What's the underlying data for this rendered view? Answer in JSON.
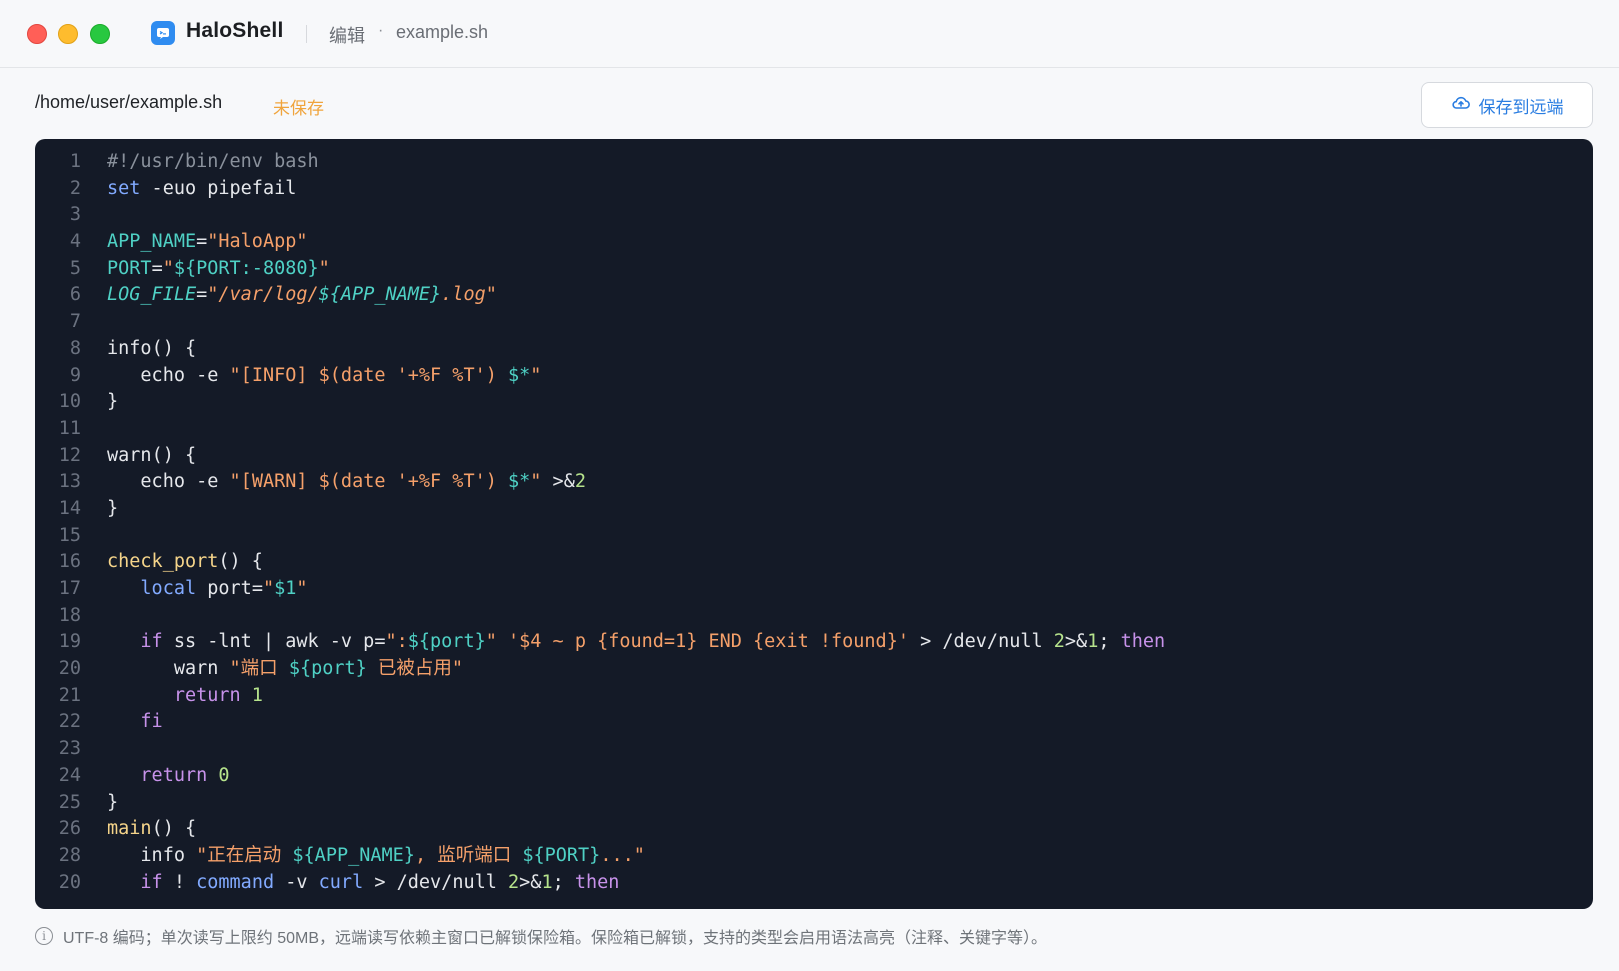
{
  "titlebar": {
    "app_name": "HaloShell",
    "mode": "编辑",
    "separator": "·",
    "file_name": "example.sh"
  },
  "toolbar": {
    "path": "/home/user/example.sh",
    "status": "未保存",
    "save_label": "保存到远端",
    "save_icon": "cloud-upload-icon"
  },
  "editor": {
    "lines": [
      {
        "n": "1",
        "code": "#!/usr/bin/env bash"
      },
      {
        "n": "2",
        "code": "set -euo pipefail"
      },
      {
        "n": "3",
        "code": ""
      },
      {
        "n": "4",
        "code": "APP_NAME=\"HaloApp\""
      },
      {
        "n": "5",
        "code": "PORT=\"${PORT:-8080}\""
      },
      {
        "n": "6",
        "code": "LOG_FILE=\"/var/log/${APP_NAME}.log\""
      },
      {
        "n": "7",
        "code": ""
      },
      {
        "n": "8",
        "code": "info() {"
      },
      {
        "n": "9",
        "code": "   echo -e \"[INFO] $(date '+%F %T') $*\""
      },
      {
        "n": "10",
        "code": "}"
      },
      {
        "n": "11",
        "code": ""
      },
      {
        "n": "12",
        "code": "warn() {"
      },
      {
        "n": "13",
        "code": "   echo -e \"[WARN] $(date '+%F %T') $*\" >&2"
      },
      {
        "n": "14",
        "code": "}"
      },
      {
        "n": "15",
        "code": ""
      },
      {
        "n": "16",
        "code": "check_port() {"
      },
      {
        "n": "17",
        "code": "   local port=\"$1\""
      },
      {
        "n": "18",
        "code": ""
      },
      {
        "n": "19",
        "code": "   if ss -lnt | awk -v p=\":${port}\" '$4 ~ p {found=1} END {exit !found}' > /dev/null 2>&1; then"
      },
      {
        "n": "20",
        "code": "      warn \"端口 ${port} 已被占用\""
      },
      {
        "n": "21",
        "code": "      return 1"
      },
      {
        "n": "22",
        "code": "   fi"
      },
      {
        "n": "23",
        "code": ""
      },
      {
        "n": "24",
        "code": "   return 0"
      },
      {
        "n": "25",
        "code": "}"
      },
      {
        "n": "26",
        "code": "main() {"
      },
      {
        "n": "28",
        "code": "   info \"正在启动 ${APP_NAME}, 监听端口 ${PORT}...\""
      },
      {
        "n": "20",
        "code": "   if ! command -v curl > /dev/null 2>&1; then"
      }
    ]
  },
  "footer": {
    "icon": "info-icon",
    "text": "UTF-8 编码；单次读写上限约 50MB，远端读写依赖主窗口已解锁保险箱。保险箱已解锁，支持的类型会启用语法高亮（注释、关键字等）。"
  },
  "colors": {
    "editor_bg": "#141a27",
    "accent": "#2a7de1",
    "unsaved": "#f0a43c"
  }
}
